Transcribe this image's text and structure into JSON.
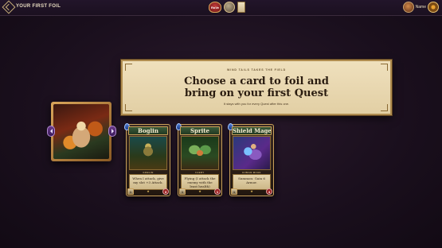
{
  "header": {
    "title": "YOUR FIRST FOIL",
    "heart_label": "RoVe",
    "coin_label": "",
    "user_name": "Name"
  },
  "prompt": {
    "eyebrow": "WIND TAILS TAKES THE FIELD",
    "headline_line1": "Choose a card to foil and",
    "headline_line2": "bring on your first Quest",
    "subtext": "It stays with you for every Quest after this one."
  },
  "cards": [
    {
      "name": "Boglin",
      "type": "GOBLIN",
      "text": "When I attack, give my slot +3 Attack.",
      "attack": "1",
      "health": "3",
      "rarity": "★"
    },
    {
      "name": "Sprite",
      "type": "FAERY",
      "text": "Flying (I attack the enemy with the least health)",
      "attack": "1",
      "health": "1",
      "rarity": "★"
    },
    {
      "name": "Shield Mage",
      "type": "HUMAN MAGE",
      "text": "Summon: Gain 6 Armor.",
      "attack": "1",
      "health": "4",
      "rarity": "★"
    }
  ],
  "colors": {
    "background": "#1a0f1d",
    "parchment": "#efe0bd",
    "gold_trim": "#c9a05a",
    "card_banner": "#3a5a3a"
  }
}
